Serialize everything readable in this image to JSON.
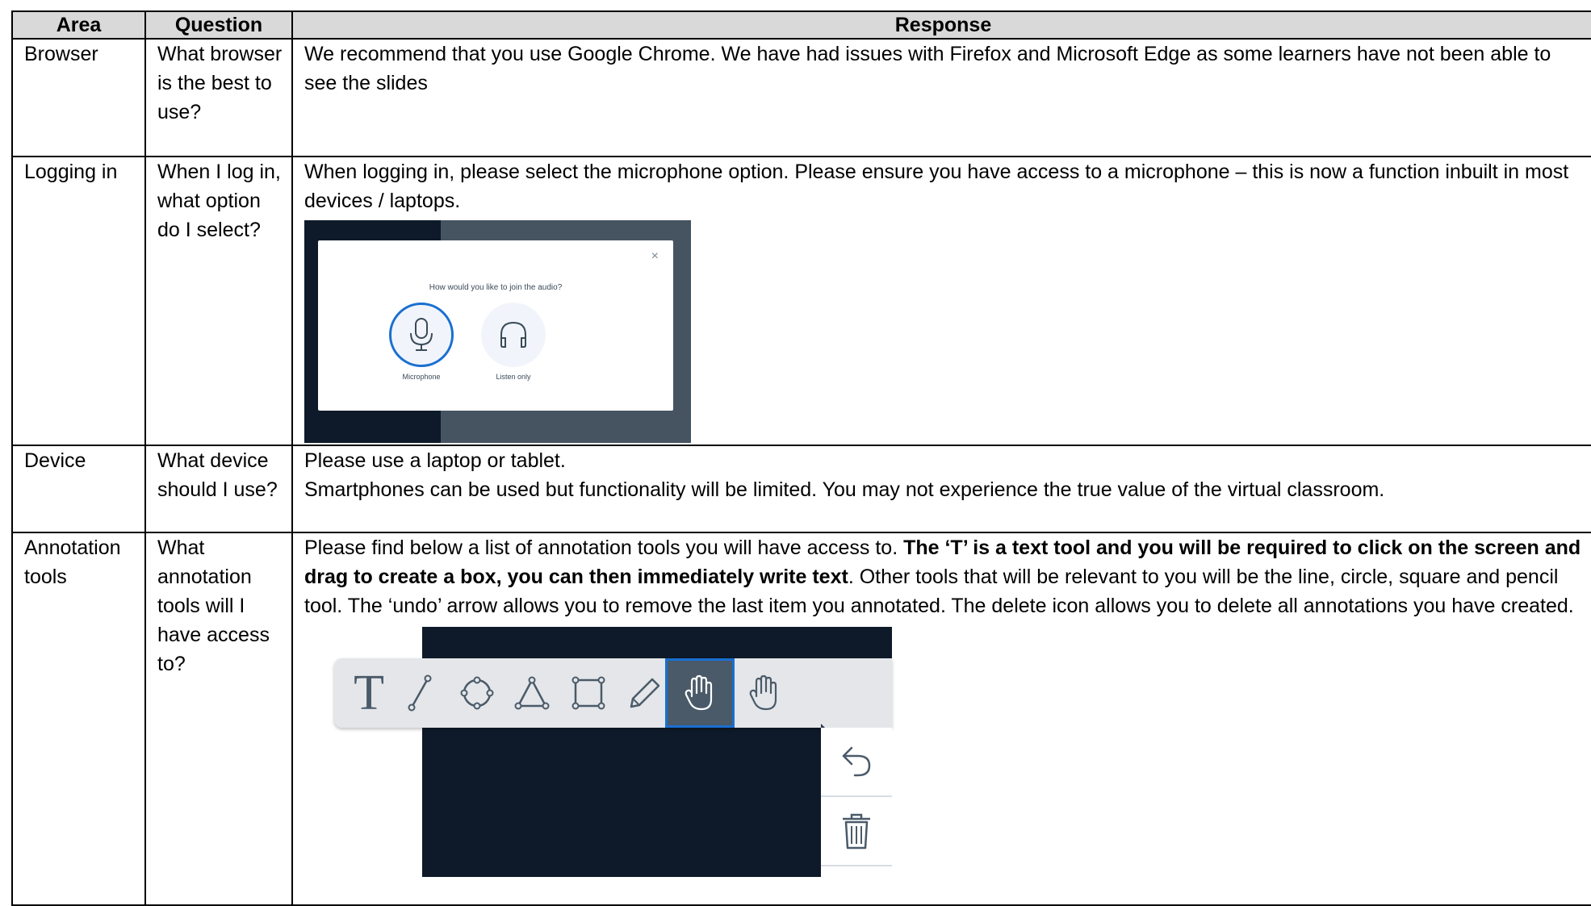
{
  "table": {
    "headers": {
      "area": "Area",
      "question": "Question",
      "response": "Response"
    },
    "rows": [
      {
        "area": "Browser",
        "question": "What browser is the best to use?",
        "response": "We recommend that you use Google Chrome. We have had issues with Firefox and Microsoft Edge as some learners have not been able to see the slides"
      },
      {
        "area": "Logging in",
        "question": "When I log in, what option do I select?",
        "response": "When logging in, please select the microphone option. Please ensure you have access to a microphone – this is now a function inbuilt in most devices / laptops.",
        "dialog": {
          "prompt": "How would you like to join the audio?",
          "close": "×",
          "option_microphone": "Microphone",
          "option_listen": "Listen only",
          "selected": "Microphone"
        }
      },
      {
        "area": "Device",
        "question": "What device should I use?",
        "response_line1": "Please use a laptop or tablet.",
        "response_line2": "Smartphones can be used but functionality will be limited. You may not experience the true value of the virtual classroom."
      },
      {
        "area": "Annotation tools",
        "question": "What annotation tools will I have access to?",
        "response_intro": "Please find below a list of annotation tools you will have access to. ",
        "response_bold": "The ‘T’ is a text tool and you will be required to click on the screen and drag to create a box, you can then immediately write text",
        "response_rest": ". Other tools that will be relevant to you will be the line, circle, square and pencil tool. The ‘undo’ arrow allows you to remove the last item you annotated. The delete icon allows you to delete all annotations you have created.",
        "toolbar": {
          "text_tool_glyph": "T",
          "tools": [
            "text-tool",
            "line-tool",
            "circle-tool",
            "triangle-tool",
            "square-tool",
            "pencil-tool",
            "hand-tool",
            "hand-tool"
          ],
          "active_tool": "hand-tool",
          "side_tools": [
            "undo-tool",
            "delete-tool"
          ]
        }
      }
    ]
  },
  "colors": {
    "header_bg": "#d9d9d9",
    "dark_bg": "#0e1a29",
    "accent_blue": "#1a6fd1",
    "toolbar_bg": "#e4e6e9"
  }
}
